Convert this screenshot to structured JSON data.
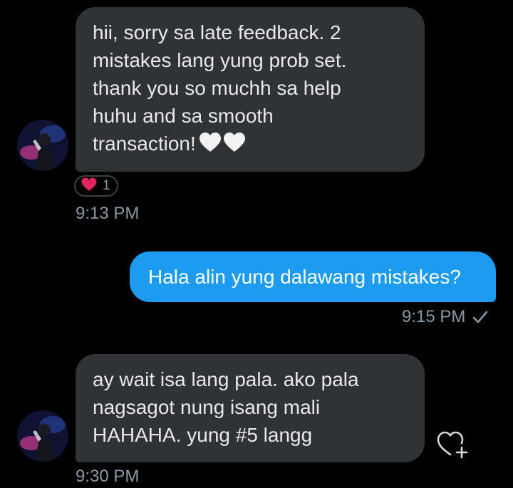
{
  "conversation": {
    "messages": [
      {
        "direction": "incoming",
        "lines": [
          "hii, sorry sa late feedback. 2",
          "mistakes lang yung prob set.",
          "thank you so muchh sa help",
          "huhu and sa smooth",
          "transaction!"
        ],
        "emoji": "two white hearts",
        "reaction": {
          "icon": "heart-icon",
          "count": "1",
          "color": "#f91880"
        },
        "time": "9:13 PM"
      },
      {
        "direction": "outgoing",
        "lines": [
          "Hala alin yung dalawang mistakes?"
        ],
        "time": "9:15 PM",
        "status_icon": "checkmark-icon"
      },
      {
        "direction": "incoming",
        "lines": [
          "ay wait isa lang pala. ako pala",
          "nagsagot nung isang mali",
          "HAHAHA. yung #5 langg"
        ],
        "time": "9:30 PM",
        "action_icon": "add-reaction-icon"
      }
    ]
  },
  "colors": {
    "background": "#000000",
    "incoming_bubble": "#2f3336",
    "outgoing_bubble": "#1d9bf0",
    "timestamp": "#8b98a5",
    "reaction_heart": "#f91880"
  }
}
